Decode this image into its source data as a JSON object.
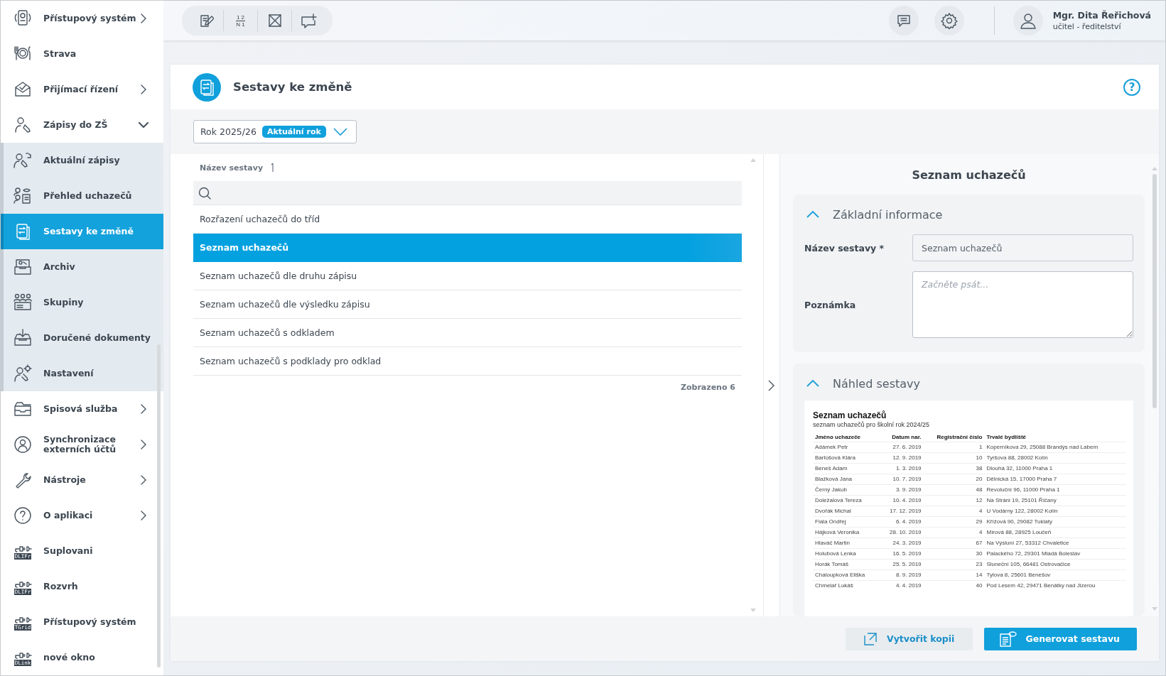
{
  "sidebar": {
    "items": [
      {
        "label": "Přístupový systém",
        "kind": "group",
        "expanded": false,
        "selected": false
      },
      {
        "label": "Strava",
        "kind": "link",
        "selected": false
      },
      {
        "label": "Přijímací řízení",
        "kind": "group",
        "expanded": false,
        "selected": false
      },
      {
        "label": "Zápisy do ZŠ",
        "kind": "group",
        "expanded": true,
        "selected": false,
        "children": [
          {
            "label": "Aktuální zápisy",
            "selected": false
          },
          {
            "label": "Přehled uchazečů",
            "selected": false
          },
          {
            "label": "Sestavy ke změně",
            "selected": true
          },
          {
            "label": "Archiv",
            "selected": false
          },
          {
            "label": "Skupiny",
            "selected": false
          },
          {
            "label": "Doručené dokumenty",
            "selected": false
          },
          {
            "label": "Nastavení",
            "selected": false
          }
        ]
      },
      {
        "label": "Spisová služba",
        "kind": "group",
        "expanded": false,
        "selected": false
      },
      {
        "label": "Synchronizace externích účtů",
        "kind": "group",
        "expanded": false,
        "selected": false
      },
      {
        "label": "Nástroje",
        "kind": "group",
        "expanded": false,
        "selected": false
      },
      {
        "label": "O aplikaci",
        "kind": "group",
        "expanded": false,
        "selected": false
      },
      {
        "label": "Suplovani",
        "kind": "plugin",
        "tag": "DLIFr",
        "selected": false
      },
      {
        "label": "Rozvrh",
        "kind": "plugin",
        "tag": "DLIFr",
        "selected": false
      },
      {
        "label": "Přístupový systém",
        "kind": "plugin",
        "tag": "TGrid",
        "selected": false
      },
      {
        "label": "nové okno",
        "kind": "plugin",
        "tag": "DLink",
        "selected": false
      }
    ]
  },
  "toolbar": [
    {
      "kind": "edit"
    },
    {
      "kind": "numbering",
      "lines": [
        "1 2",
        "N 1"
      ]
    },
    {
      "kind": "close-box"
    },
    {
      "kind": "comment-add"
    }
  ],
  "user": {
    "name": "Mgr. Dita Řeřichová",
    "role": "učitel - ředitelství"
  },
  "page": {
    "title": "Sestavy ke změně",
    "help": "?"
  },
  "year_filter": {
    "value": "Rok 2025/26",
    "badge": "Aktuální rok"
  },
  "list": {
    "column": "Název sestavy",
    "rows": [
      {
        "label": "Rozřazení uchazečů do tříd",
        "selected": false
      },
      {
        "label": "Seznam uchazečů",
        "selected": true
      },
      {
        "label": "Seznam uchazečů dle druhu zápisu",
        "selected": false
      },
      {
        "label": "Seznam uchazečů dle výsledku zápisu",
        "selected": false
      },
      {
        "label": "Seznam uchazečů s odkladem",
        "selected": false
      },
      {
        "label": "Seznam uchazečů s podklady pro odklad",
        "selected": false
      }
    ],
    "count": "Zobrazeno 6"
  },
  "detail": {
    "title": "Seznam uchazečů",
    "basic": {
      "heading": "Základní informace",
      "expanded": true,
      "name_label": "Název sestavy *",
      "name_value": "Seznam uchazečů",
      "note_label": "Poznámka",
      "note_placeholder": "Začněte psát..."
    },
    "preview": {
      "heading": "Náhled sestavy",
      "expanded": true,
      "doc_title": "Seznam uchazečů",
      "doc_subtitle": "seznam uchazečů pro školní rok 2024/25",
      "columns": [
        "Jméno uchazeče",
        "Datum nar.",
        "Registrační číslo",
        "Trvalé bydliště"
      ],
      "rows": [
        [
          "Adámek Petr",
          "27. 6. 2019",
          "1",
          "Koperníkova 29, 25088 Brandýs nad Labem"
        ],
        [
          "Bartošová Klára",
          "12. 9. 2019",
          "10",
          "Tyršova 88, 28002 Kolín"
        ],
        [
          "Beneš Adam",
          "1. 3. 2019",
          "38",
          "Dlouhá 32, 11000 Praha 1"
        ],
        [
          "Blažková Jana",
          "10. 7. 2019",
          "20",
          "Dělnická 15, 17000 Praha 7"
        ],
        [
          "Černý Jakub",
          "3. 9. 2019",
          "48",
          "Revoluční 96, 11000 Praha 1"
        ],
        [
          "Doležalová Tereza",
          "10. 4. 2019",
          "12",
          "Na Stráni 19, 25101 Říčany"
        ],
        [
          "Dvořák Michal",
          "17. 12. 2019",
          "4",
          "U Vodárny 122, 28002 Kolín"
        ],
        [
          "Fiala Ondřej",
          "6. 4. 2019",
          "29",
          "Křížová 90, 29082 Tuklaty"
        ],
        [
          "Hájková Veronika",
          "28. 10. 2019",
          "4",
          "Mírová 88, 28925 Loučeň"
        ],
        [
          "Hlaváč Martin",
          "24. 3. 2019",
          "67",
          "Na Výsluní 27, 53312 Chvaletice"
        ],
        [
          "Holubová Lenka",
          "16. 5. 2019",
          "30",
          "Palackého 72, 29301 Mladá Boleslav"
        ],
        [
          "Horák Tomáš",
          "25. 5. 2019",
          "23",
          "Sluneční 105, 66481 Ostrovačice"
        ],
        [
          "Chaloupková Eliška",
          "8. 9. 2019",
          "14",
          "Tylova 8, 25601 Benešov"
        ],
        [
          "Chmelař Lukáš",
          "4. 4. 2019",
          "40",
          "Pod Lesem 42, 29471 Benátky nad Jizerou"
        ]
      ]
    }
  },
  "buttons": [
    {
      "label": "Vytvořit kopii",
      "kind": "secondary"
    },
    {
      "label": "Generovat sestavu",
      "kind": "primary"
    }
  ]
}
